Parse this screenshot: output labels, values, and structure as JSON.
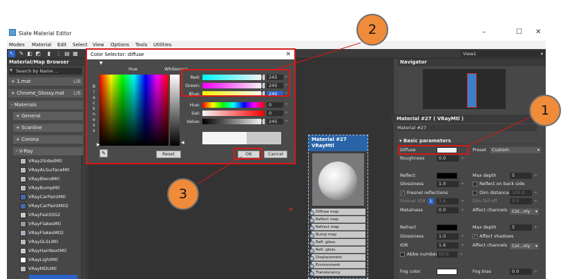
{
  "window": {
    "title": "Slate Material Editor"
  },
  "menu": [
    "Modes",
    "Material",
    "Edit",
    "Select",
    "View",
    "Options",
    "Tools",
    "Utilities"
  ],
  "view_dropdown": "View1",
  "browser": {
    "title": "Material/Map Browser",
    "search_placeholder": "Search by Name ...",
    "groups": [
      {
        "label": "+ 1.mat",
        "tag": "LIB"
      },
      {
        "label": "+ Chrome_Glossy.mat",
        "tag": "LIB"
      },
      {
        "label": "- Materials",
        "tag": ""
      }
    ],
    "subgroups": [
      "+ General",
      "+ Scanline",
      "+ Corona",
      "- V-Ray"
    ],
    "materials": [
      "VRay2SidedMtl",
      "VRayALSurfaceMtl",
      "VRayBlendMtl",
      "VRayBumpMtl",
      "VRayCarPaintMtl",
      "VRayCarPaintMtl2",
      "VRayFastSSS2",
      "VRayFlakesMtl",
      "VRayFlakesMtl2",
      "VRayGLSLMtl",
      "VRayHairNextMtl",
      "VRayLightMtl",
      "VRayMDLMtl"
    ]
  },
  "node": {
    "title": "Material #27",
    "type": "VRayMtl",
    "ports": [
      "Diffuse map",
      "Reflect map",
      "Refract map",
      "Bump map",
      "Refl. gloss.",
      "Refr. gloss.",
      "Displacement",
      "Environment",
      "Translucency"
    ]
  },
  "navigator": {
    "title": "Navigator"
  },
  "params": {
    "panel_title": "Material #27  ( VRayMtl )",
    "material_name": "Material #27",
    "section": "Basic parameters",
    "diffuse_label": "Diffuse",
    "roughness_label": "Roughness",
    "roughness_value": "0.0",
    "preset_label": "Preset",
    "preset_value": "Custom",
    "reflect_label": "Reflect",
    "max_depth_label": "Max depth",
    "max_depth_value": "5",
    "glossiness_label": "Glossiness",
    "glossiness_value": "1.0",
    "reflect_back_label": "Reflect on back side",
    "fresnel_label": "Fresnel reflections",
    "dim_distance_label": "Dim distance",
    "dim_distance_value": "100.0",
    "fresnel_ior_label": "Fresnel IOR",
    "fresnel_ior_lock": "L",
    "fresnel_ior_value": "1.6",
    "dim_falloff_label": "Dim fall off",
    "dim_falloff_value": "0.0",
    "metalness_label": "Metalness",
    "metalness_value": "0.0",
    "affect_channels_label": "Affect channels",
    "affect_channels_value": "Col...nly",
    "refract_label": "Refract",
    "refract_max_depth_label": "Max depth",
    "refract_max_depth_value": "5",
    "refract_glossiness_label": "Glossiness",
    "refract_glossiness_value": "1.0",
    "affect_shadows_label": "Affect shadows",
    "ior_label": "IOR",
    "ior_value": "1.6",
    "refract_affect_channels_label": "Affect channels",
    "refract_affect_channels_value": "Col...nly",
    "abbe_label": "Abbe number",
    "abbe_value": "50.0",
    "fog_color_label": "Fog color",
    "fog_bias_label": "Fog bias",
    "fog_bias_value": "0.0"
  },
  "dialog": {
    "title": "Color Selector: diffuse",
    "hue_label": "Hue",
    "whiteness_label": "Whiteness",
    "blackness_letters": [
      "B",
      "l",
      "a",
      "c",
      "k",
      "n",
      "e",
      "s",
      "s"
    ],
    "red_label": "Red:",
    "red_value": "245",
    "green_label": "Green:",
    "green_value": "245",
    "blue_label": "Blue:",
    "blue_value": "245",
    "hue_row_label": "Hue:",
    "hue_value": "0",
    "sat_label": "Sat:",
    "sat_value": "0",
    "value_label": "Value:",
    "value_value": "245",
    "reset_label": "Reset",
    "ok_label": "OK",
    "cancel_label": "Cancel"
  },
  "callouts": [
    "2",
    "1",
    "3"
  ],
  "colors": {
    "highlight": "#d81818",
    "callout": "#f08b3a",
    "node_header": "#2a64a8"
  }
}
